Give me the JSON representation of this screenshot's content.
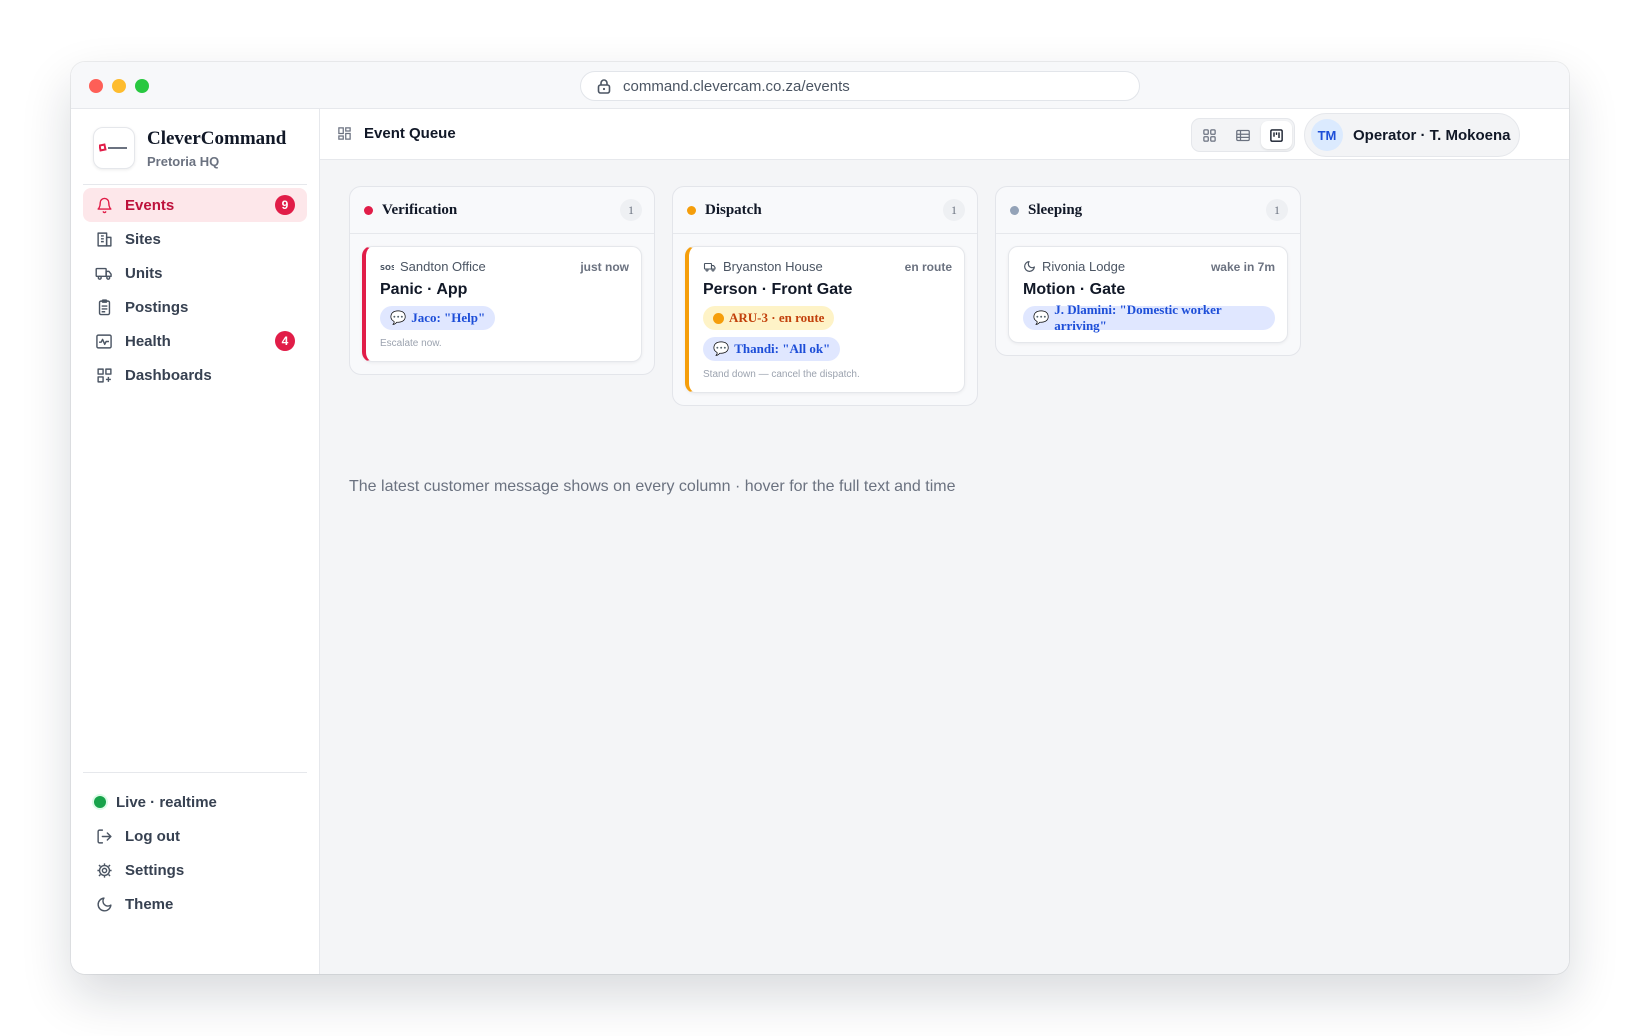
{
  "browser": {
    "url": "command.clevercam.co.za/events"
  },
  "brand": {
    "name": "CleverCommand",
    "location": "Pretoria HQ"
  },
  "sidebar": {
    "items": [
      {
        "label": "Events",
        "badge": "9",
        "icon": "bell-icon",
        "active": true
      },
      {
        "label": "Sites",
        "icon": "building-icon"
      },
      {
        "label": "Units",
        "icon": "truck-icon"
      },
      {
        "label": "Postings",
        "icon": "clipboard-icon"
      },
      {
        "label": "Health",
        "badge": "4",
        "icon": "pulse-icon"
      },
      {
        "label": "Dashboards",
        "icon": "dashboard-icon"
      }
    ],
    "bottom": {
      "status": "Live · realtime",
      "logout": "Log out",
      "settings": "Settings",
      "theme": "Theme"
    }
  },
  "header": {
    "title": "Event Queue",
    "view_modes": [
      "grid",
      "list",
      "board"
    ],
    "active_view": "board",
    "operator_initials": "TM",
    "operator_name": "Operator · T. Mokoena"
  },
  "columns": [
    {
      "title": "Verification",
      "count": "1",
      "color": "#e11d48",
      "card": {
        "site": "Sandton Office",
        "meta": "just now",
        "title": "Panic · App",
        "message": "Jaco: \"Help\"",
        "note": "Escalate now."
      }
    },
    {
      "title": "Dispatch",
      "count": "1",
      "color": "#f59e0b",
      "card": {
        "site": "Bryanston House",
        "meta": "en route",
        "title": "Person · Front Gate",
        "unit_status": "ARU-3 · en route",
        "message": "Thandi: \"All ok\"",
        "note": "Stand down — cancel the dispatch."
      }
    },
    {
      "title": "Sleeping",
      "count": "1",
      "color": "#94a3b8",
      "card": {
        "site": "Rivonia Lodge",
        "meta": "wake in 7m",
        "title": "Motion · Gate",
        "message": "J. Dlamini: \"Domestic worker arriving\""
      }
    }
  ],
  "hint": "The latest customer message shows on every column · hover for the full text and time"
}
